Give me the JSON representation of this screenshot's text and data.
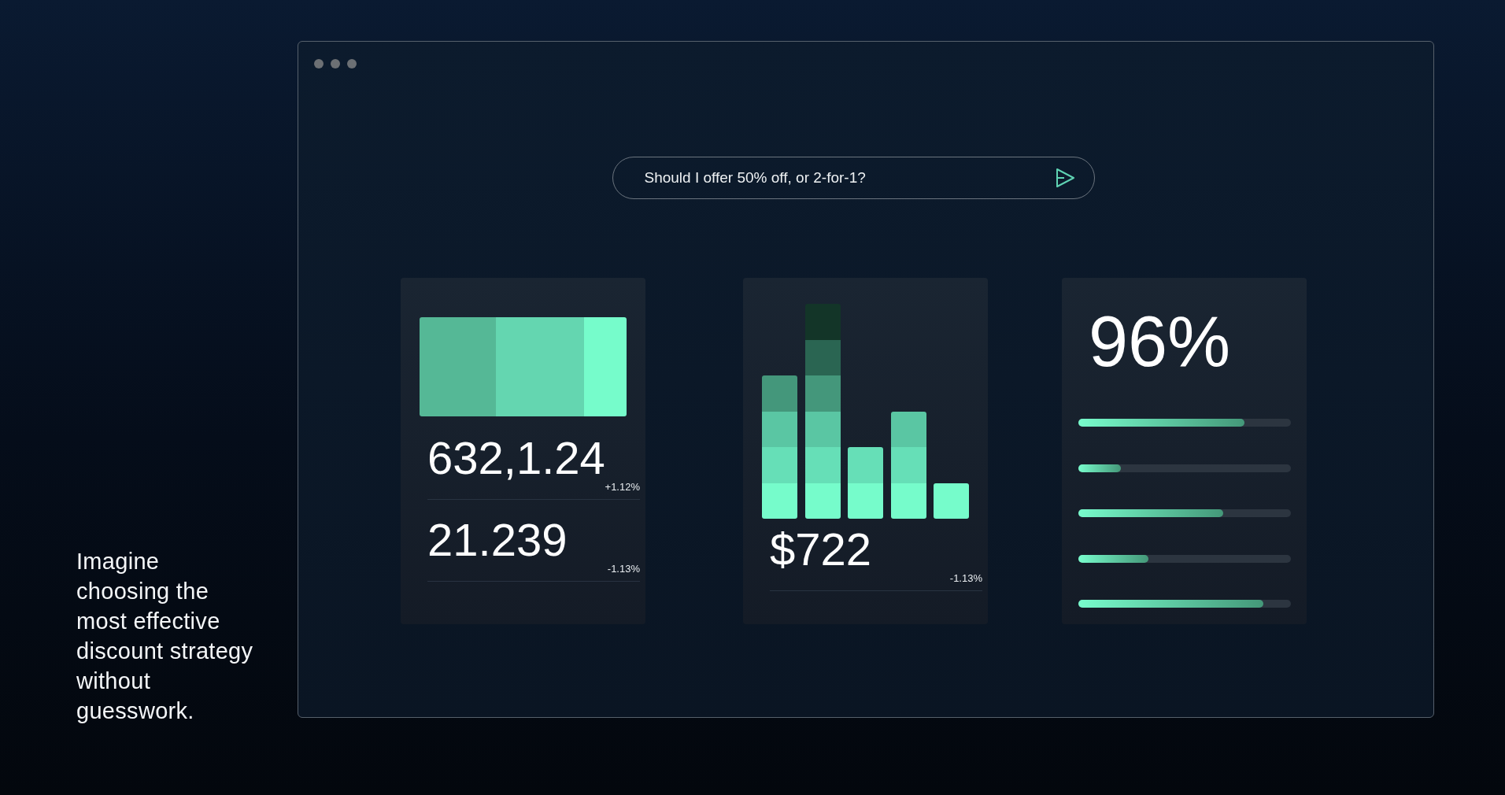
{
  "tagline": "Imagine choosing the most effective discount strategy without guesswork.",
  "window": {
    "search": {
      "value": "Should I offer 50% off, or 2-for-1?"
    },
    "cards": [
      {
        "kind": "stacked",
        "metrics": [
          {
            "value": "632,1.24",
            "change": "+1.12%"
          },
          {
            "value": "21.239",
            "change": "-1.13%"
          }
        ]
      },
      {
        "kind": "bars",
        "metrics": [
          {
            "value": "$722",
            "change": "-1.13%"
          }
        ]
      },
      {
        "kind": "progress",
        "headline": "96%",
        "bars": [
          {
            "level": 0.78
          },
          {
            "level": 0.2
          },
          {
            "level": 0.68
          },
          {
            "level": 0.33
          },
          {
            "level": 0.87
          }
        ]
      }
    ]
  }
}
